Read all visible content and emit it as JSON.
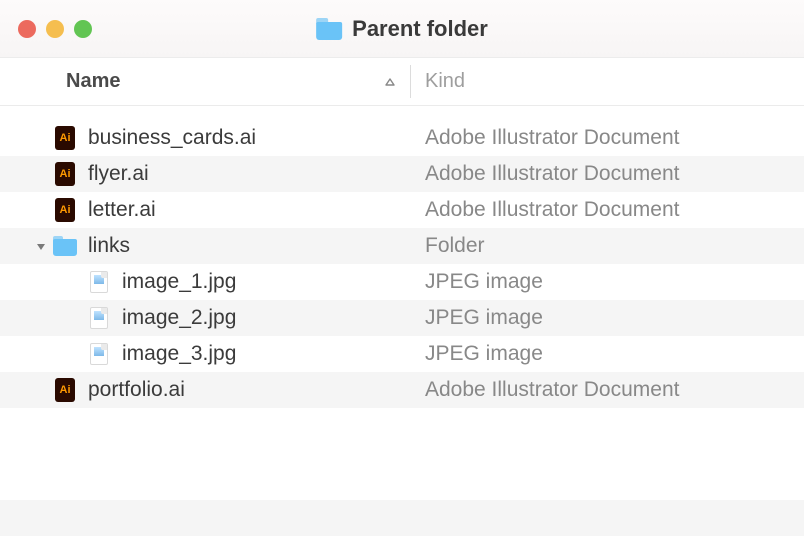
{
  "window": {
    "title": "Parent folder"
  },
  "columns": {
    "name": "Name",
    "kind": "Kind"
  },
  "rows": [
    {
      "depth": 0,
      "icon": "ai",
      "name": "business_cards.ai",
      "kind": "Adobe Illustrator Document",
      "expandable": false,
      "expanded": false,
      "alt": false
    },
    {
      "depth": 0,
      "icon": "ai",
      "name": "flyer.ai",
      "kind": "Adobe Illustrator Document",
      "expandable": false,
      "expanded": false,
      "alt": true
    },
    {
      "depth": 0,
      "icon": "ai",
      "name": "letter.ai",
      "kind": "Adobe Illustrator Document",
      "expandable": false,
      "expanded": false,
      "alt": false
    },
    {
      "depth": 0,
      "icon": "folder",
      "name": "links",
      "kind": "Folder",
      "expandable": true,
      "expanded": true,
      "alt": true
    },
    {
      "depth": 1,
      "icon": "jpg",
      "name": "image_1.jpg",
      "kind": "JPEG image",
      "expandable": false,
      "expanded": false,
      "alt": false
    },
    {
      "depth": 1,
      "icon": "jpg",
      "name": "image_2.jpg",
      "kind": "JPEG image",
      "expandable": false,
      "expanded": false,
      "alt": true
    },
    {
      "depth": 1,
      "icon": "jpg",
      "name": "image_3.jpg",
      "kind": "JPEG image",
      "expandable": false,
      "expanded": false,
      "alt": false
    },
    {
      "depth": 0,
      "icon": "ai",
      "name": "portfolio.ai",
      "kind": "Adobe Illustrator Document",
      "expandable": false,
      "expanded": false,
      "alt": true
    }
  ]
}
